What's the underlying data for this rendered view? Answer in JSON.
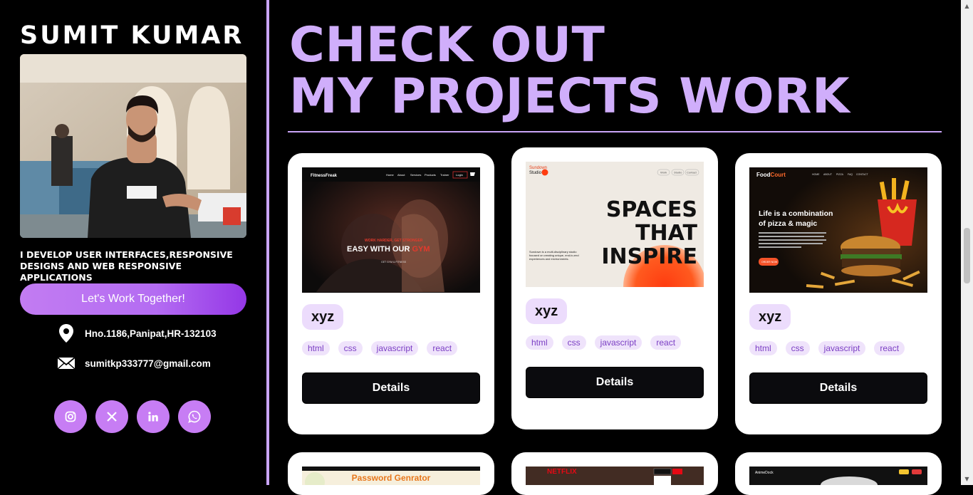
{
  "sidebar": {
    "name": "SUMIT KUMAR",
    "tagline": "I DEVELOP USER INTERFACES,RESPONSIVE DESIGNS AND WEB RESPONSIVE APPLICATIONS",
    "cta_label": "Let's Work Together!",
    "address": "Hno.1186,Panipat,HR-132103",
    "email": "sumitkp333777@gmail.com",
    "socials": [
      "instagram-icon",
      "x-icon",
      "linkedin-icon",
      "whatsapp-icon"
    ]
  },
  "main": {
    "title_line1": "CHECK OUT",
    "title_line2": "MY PROJECTS WORK",
    "projects": [
      {
        "title": "xyz",
        "tags": [
          "html",
          "css",
          "javascript",
          "react"
        ],
        "details_label": "Details",
        "screenshot": {
          "brand": "FitnessFreak",
          "nav": [
            "Home",
            "About",
            "Services",
            "Products",
            "Trainer",
            "Login"
          ],
          "kicker": "WORK HARDER, GET STRONGER",
          "headline_a": "EASY WITH OUR",
          "headline_b": "GYM",
          "button": "GET GYM & FITNESS"
        }
      },
      {
        "title": "xyz",
        "tags": [
          "html",
          "css",
          "javascript",
          "react"
        ],
        "details_label": "Details",
        "screenshot": {
          "brand_a": "Sundown",
          "brand_b": "Studio",
          "nav": [
            "Work",
            "Studio",
            "Contact"
          ],
          "headline": [
            "SPACES",
            "THAT",
            "INSPIRE"
          ],
          "blurb": "Sundown is a multi-disciplinary studio focused on creating unique, end-to-end experiences and environments."
        }
      },
      {
        "title": "xyz",
        "tags": [
          "html",
          "css",
          "javascript",
          "react"
        ],
        "details_label": "Details",
        "screenshot": {
          "brand_a": "Food",
          "brand_b": "Court",
          "nav": [
            "HOME",
            "ABOUT",
            "PIZZA",
            "FAQ",
            "CONTACT"
          ],
          "headline": [
            "Life is a combination",
            "of pizza & magic"
          ],
          "button": "ORDER NOW"
        }
      },
      {
        "screenshot": {
          "label": "Password Genrator"
        }
      },
      {
        "screenshot": {
          "label": "NETFLIX"
        }
      },
      {
        "screenshot": {
          "label": "AnimeDock"
        }
      }
    ]
  },
  "colors": {
    "accent": "#d0aefb",
    "accent_dark": "#9437e6",
    "social_bg": "#c77df4",
    "tag_bg": "#efe3fb",
    "title_pill_bg": "#ecdcfc"
  }
}
